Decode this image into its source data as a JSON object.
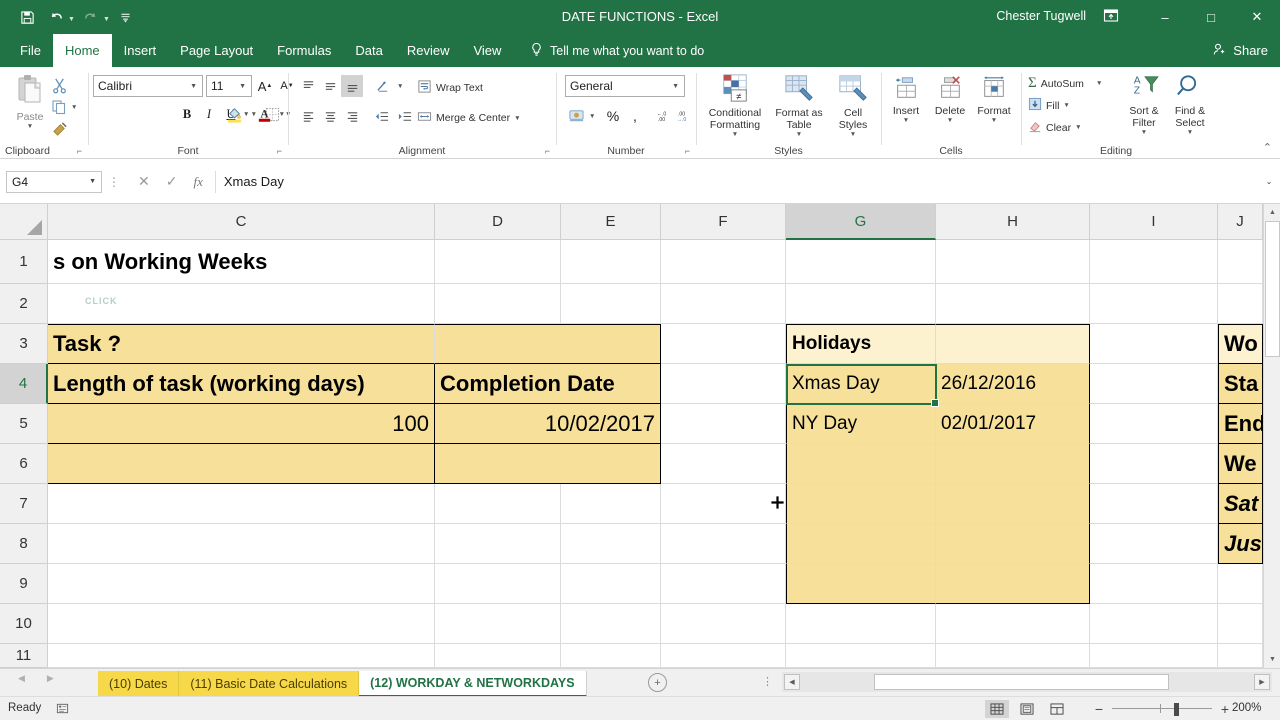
{
  "titlebar": {
    "document_title": "DATE FUNCTIONS - Excel",
    "user_name": "Chester Tugwell",
    "qat": [
      {
        "name": "save-icon",
        "glyph": "ὋE"
      },
      {
        "name": "undo-icon",
        "glyph": "↶"
      },
      {
        "name": "redo-icon",
        "glyph": "↷"
      },
      {
        "name": "customize-qat-icon",
        "glyph": "≡"
      }
    ],
    "ribbon_display_options": "⤓",
    "minimize": "–",
    "maximize": "□",
    "close": "✕"
  },
  "ribbon_tabs": [
    {
      "label": "File",
      "active": false
    },
    {
      "label": "Home",
      "active": true
    },
    {
      "label": "Insert",
      "active": false
    },
    {
      "label": "Page Layout",
      "active": false
    },
    {
      "label": "Formulas",
      "active": false
    },
    {
      "label": "Data",
      "active": false
    },
    {
      "label": "Review",
      "active": false
    },
    {
      "label": "View",
      "active": false
    }
  ],
  "tellme": {
    "label": "Tell me what you want to do",
    "icon": "lightbulb-icon"
  },
  "share": {
    "label": "Share",
    "icon": "share-person-icon"
  },
  "ribbon": {
    "clipboard": {
      "group_label": "Clipboard",
      "paste_label": "Paste",
      "cut_label": "Cut",
      "copy_label": "Copy",
      "format_painter_label": "Format Painter"
    },
    "font": {
      "group_label": "Font",
      "font_family_value": "Calibri",
      "font_size_value": "11",
      "grow_font": "A",
      "shrink_font": "A",
      "bold": "B",
      "italic": "I",
      "underline": "U",
      "borders": "borders-icon",
      "fill_color": "fill-color-icon",
      "font_color": "A"
    },
    "alignment": {
      "group_label": "Alignment",
      "wrap_text_label": "Wrap Text",
      "merge_center_label": "Merge & Center"
    },
    "number": {
      "group_label": "Number",
      "format_value": "General",
      "accounting": "accounting-format-icon",
      "percent": "%",
      "comma": ",",
      "decrease_decimal": ".00",
      "increase_decimal": ".00"
    },
    "styles": {
      "group_label": "Styles",
      "conditional_formatting_label": "Conditional Formatting",
      "format_as_table_label": "Format as Table",
      "cell_styles_label": "Cell Styles"
    },
    "cells": {
      "group_label": "Cells",
      "insert_label": "Insert",
      "delete_label": "Delete",
      "format_label": "Format"
    },
    "editing": {
      "group_label": "Editing",
      "autosum_label": "AutoSum",
      "fill_label": "Fill",
      "clear_label": "Clear",
      "sort_filter_label": "Sort & Filter",
      "find_select_label": "Find & Select"
    },
    "collapse_ribbon": "⌃"
  },
  "formula_bar": {
    "name_box_value": "G4",
    "cancel_icon": "✕",
    "enter_icon": "✓",
    "function_icon": "fx",
    "formula_value": "Xmas Day",
    "expand_icon": "⌄"
  },
  "grid": {
    "columns": [
      "C",
      "D",
      "E",
      "F",
      "G",
      "H",
      "I",
      "J"
    ],
    "selected_column": "G",
    "rows": [
      "1",
      "2",
      "3",
      "4",
      "5",
      "6",
      "7",
      "8",
      "9",
      "10",
      "11"
    ],
    "selected_row": "4",
    "selected_cell": "G4",
    "ghost_text_row2": "CLICK",
    "cells": {
      "C1": "s on Working Weeks",
      "C3": "Task ?",
      "C4": "Length of task (working days)",
      "D4": "Completion Date",
      "C5": "100",
      "D5": "10/02/2017",
      "G3": "Holidays",
      "G4": "Xmas Day",
      "H4": "26/12/2016",
      "G5": "NY Day",
      "H5": "02/01/2017",
      "J3": "Wo",
      "J4": "Sta",
      "J5": "End",
      "J6": "We",
      "J7": "Sat",
      "J8": "Jus"
    }
  },
  "sheet_tabs": [
    {
      "label": "(10) Dates",
      "active": false
    },
    {
      "label": "(11) Basic Date Calculations",
      "active": false
    },
    {
      "label": "(12) WORKDAY & NETWORKDAYS",
      "active": true
    }
  ],
  "sheet_nav": {
    "prev": "◀",
    "next": "▶",
    "add_sheet": "⊕"
  },
  "status_bar": {
    "status_text": "Ready",
    "accessibility_icon": "accessibility-icon",
    "view_normal": "normal-view-icon",
    "view_page_layout": "page-layout-view-icon",
    "view_page_break": "page-break-view-icon",
    "zoom_out": "−",
    "zoom_in": "+",
    "zoom_value": "200%"
  },
  "colors": {
    "excel_green": "#217346",
    "cell_yellow": "#f7e09a",
    "cell_yellow_light": "#fcf2d0",
    "sheet_tab_yellow": "#f7d848"
  }
}
